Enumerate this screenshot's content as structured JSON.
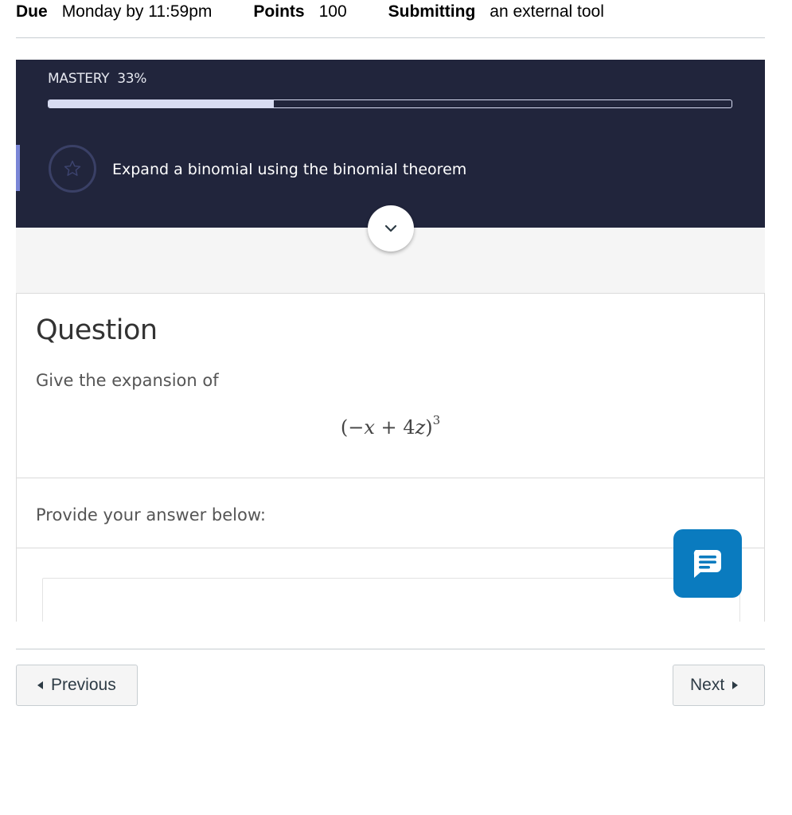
{
  "assignment_meta": {
    "due_label": "Due",
    "due_value": "Monday by 11:59pm",
    "points_label": "Points",
    "points_value": "100",
    "submitting_label": "Submitting",
    "submitting_value": "an external tool"
  },
  "mastery": {
    "label": "MASTERY",
    "percent_text": "33%",
    "progress_fraction": 0.33,
    "objective_text": "Expand a binomial using the binomial theorem",
    "objective_icon": "star-icon",
    "expand_icon": "chevron-down-icon"
  },
  "question": {
    "heading": "Question",
    "prompt": "Give the expansion of",
    "expression": {
      "open": "(",
      "minus": "−",
      "var1": "x",
      "plus": "+",
      "coef": "4",
      "var2": "z",
      "close": ")",
      "exponent": "3"
    },
    "answer_label": "Provide your answer below:"
  },
  "chat": {
    "icon": "chat-bubble-icon",
    "color": "#0a7bbf"
  },
  "navigation": {
    "previous_label": "Previous",
    "next_label": "Next"
  },
  "colors": {
    "panel_bg": "#21253c",
    "accent_marker": "#7a86d6"
  }
}
